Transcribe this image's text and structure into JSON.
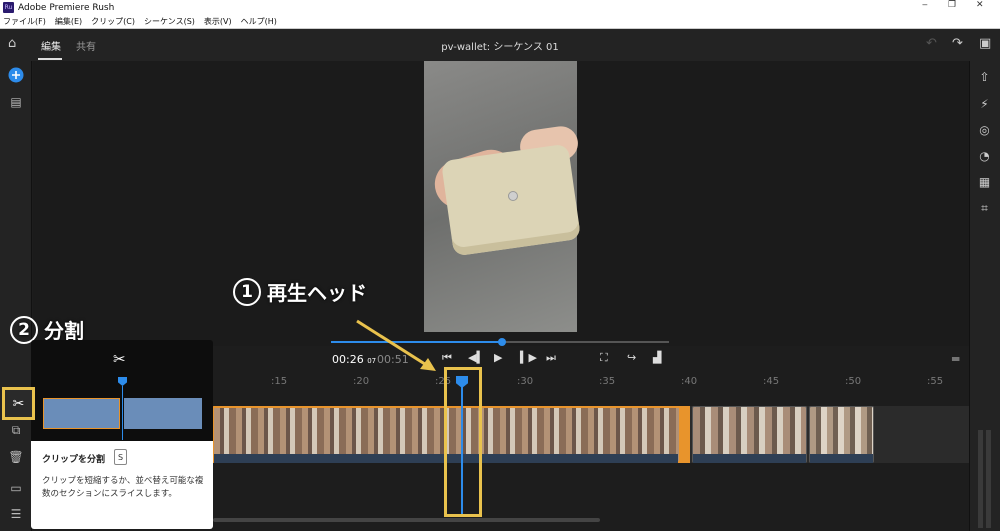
{
  "window": {
    "title": "Adobe Premiere Rush",
    "app_icon": "Ru",
    "minimize": "‒",
    "restore": "❐",
    "close": "✕"
  },
  "menu": [
    "ファイル(F)",
    "編集(E)",
    "クリップ(C)",
    "シーケンス(S)",
    "表示(V)",
    "ヘルプ(H)"
  ],
  "header": {
    "tab_edit": "編集",
    "tab_share": "共有",
    "sequence_title": "pv-wallet: シーケンス 01"
  },
  "transport": {
    "current_time": "00:26",
    "current_frames": "07",
    "duration": "00:51"
  },
  "timeline": {
    "ticks": [
      ":15",
      ":20",
      ":25",
      ":30",
      ":35",
      ":40",
      ":45",
      ":50",
      ":55"
    ]
  },
  "annotations": {
    "playhead_number": "1",
    "playhead_label": "再生ヘッド",
    "split_number": "2",
    "split_label": "分割"
  },
  "tooltip": {
    "title": "クリップを分割",
    "shortcut": "S",
    "description": "クリップを短縮するか、並べ替え可能な複数のセクションにスライスします。"
  },
  "colors": {
    "accent_blue": "#2d8ceb",
    "clip_selected": "#e8942c",
    "highlight": "#e9c24d",
    "bg": "#1d1d1d"
  },
  "icons": {
    "home": "home-icon",
    "add": "add-media-icon",
    "project": "project-panel-icon",
    "split": "scissors-icon",
    "duplicate": "duplicate-icon",
    "delete": "trash-icon",
    "undo": "undo-icon",
    "redo": "redo-icon",
    "comment": "comment-icon"
  }
}
